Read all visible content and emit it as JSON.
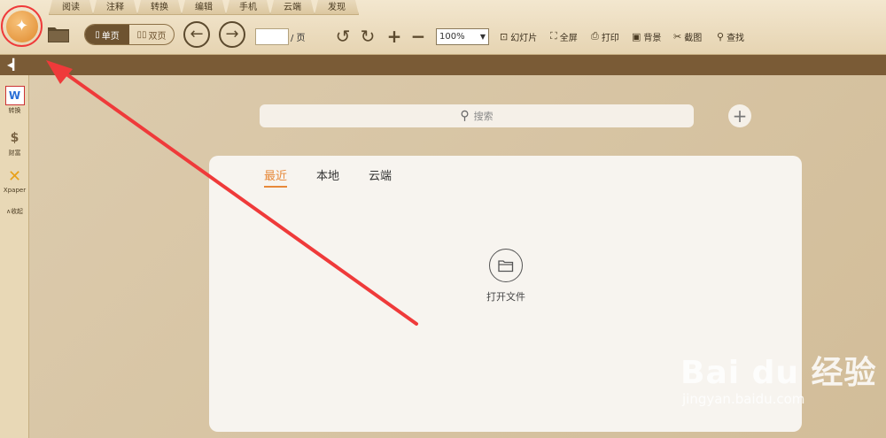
{
  "menu_tabs": [
    "阅读",
    "注释",
    "转换",
    "编辑",
    "手机",
    "云端",
    "发现"
  ],
  "toolbar": {
    "view_single": "单页",
    "view_double": "双页",
    "page_suffix": "/ 页",
    "zoom_value": "100%",
    "slideshow": "幻灯片",
    "fullscreen": "全屏",
    "print": "打印",
    "background": "背景",
    "screenshot": "截图",
    "find": "查找"
  },
  "sidebar": {
    "items": [
      {
        "label": "转换",
        "icon": "pdf-to-word-icon"
      },
      {
        "label": "财富",
        "icon": "money-bag-icon"
      },
      {
        "label": "Xpaper",
        "icon": "xpaper-icon"
      },
      {
        "label": "收起",
        "icon": "collapse-icon"
      }
    ]
  },
  "search": {
    "placeholder": "搜索"
  },
  "panel": {
    "tabs": [
      {
        "label": "最近",
        "active": true
      },
      {
        "label": "本地",
        "active": false
      },
      {
        "label": "云端",
        "active": false
      }
    ],
    "open_file_label": "打开文件"
  },
  "annotation": {
    "color": "#ef3a3a"
  },
  "watermark": {
    "main": "Bai du 经验",
    "sub": "jingyan.baidu.com"
  }
}
